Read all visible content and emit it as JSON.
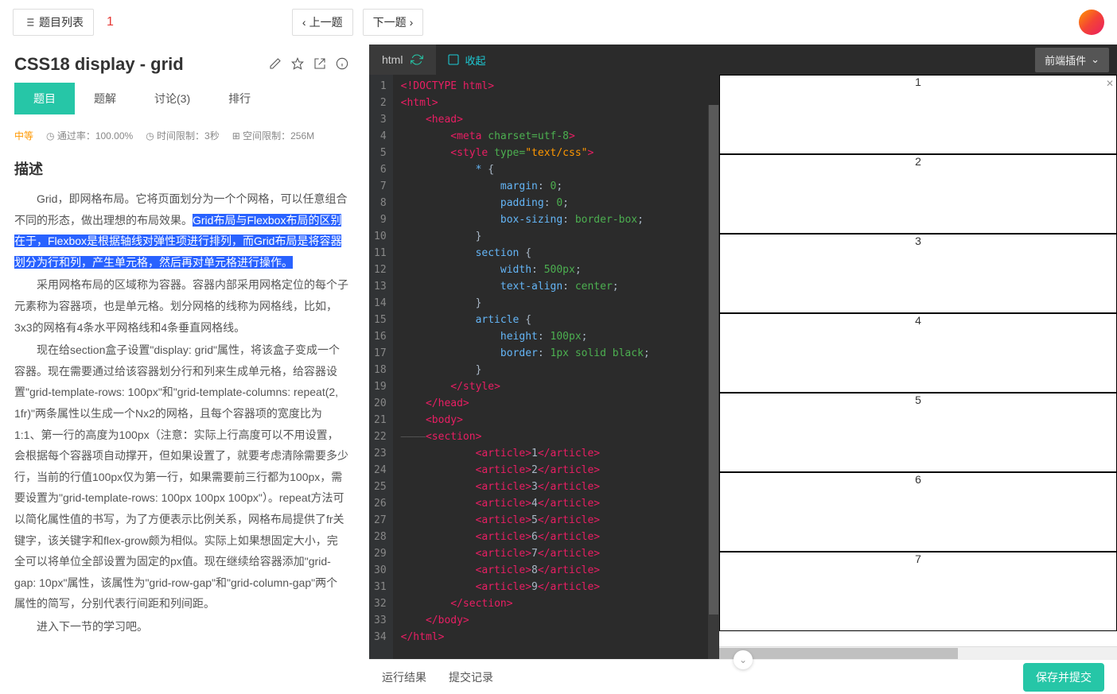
{
  "topbar": {
    "list_btn": "题目列表",
    "counter": "1",
    "prev_btn": "上一题",
    "next_btn": "下一题"
  },
  "problem": {
    "title": "CSS18  display - grid",
    "tabs": {
      "desc": "题目",
      "solution": "题解",
      "discuss": "讨论(3)",
      "rank": "排行"
    },
    "difficulty": "中等",
    "pass_rate_label": "通过率：100.00%",
    "time_limit_label": "时间限制：3秒",
    "space_limit_label": "空间限制：256M",
    "desc_heading": "描述",
    "p1a": "Grid，即网格布局。它将页面划分为一个个网格，可以任意组合不同的形态，做出理想的布局效果。",
    "p1b": "Grid布局与Flexbox布局的区别在于，Flexbox是根据轴线对弹性项进行排列，而Grid布局是将容器划分为行和列，产生单元格，然后再对单元格进行操作。",
    "p2": "采用网格布局的区域称为容器。容器内部采用网格定位的每个子元素称为容器项，也是单元格。划分网格的线称为网格线，比如，3x3的网格有4条水平网格线和4条垂直网格线。",
    "p3": "现在给section盒子设置\"display: grid\"属性，将该盒子变成一个容器。现在需要通过给该容器划分行和列来生成单元格，给容器设置\"grid-template-rows: 100px\"和\"grid-template-columns: repeat(2, 1fr)\"两条属性以生成一个Nx2的网格，且每个容器项的宽度比为1:1、第一行的高度为100px（注意：实际上行高度可以不用设置，会根据每个容器项自动撑开，但如果设置了，就要考虑清除需要多少行，当前的行值100px仅为第一行，如果需要前三行都为100px，需要设置为\"grid-template-rows: 100px 100px 100px\"）。repeat方法可以简化属性值的书写，为了方便表示比例关系，网格布局提供了fr关键字，该关键字和flex-grow颇为相似。实际上如果想固定大小，完全可以将单位全部设置为固定的px值。现在继续给容器添加\"grid-gap: 10px\"属性，该属性为\"grid-row-gap\"和\"grid-column-gap\"两个属性的简写，分别代表行间距和列间距。",
    "p4": "进入下一节的学习吧。"
  },
  "editor": {
    "lang": "html",
    "fold_label": "收起",
    "plugin_btn": "前端插件",
    "gutter": [
      "1",
      "2",
      "3",
      "4",
      "5",
      "6",
      "7",
      "8",
      "9",
      "10",
      "11",
      "12",
      "13",
      "14",
      "15",
      "16",
      "17",
      "18",
      "19",
      "20",
      "21",
      "22",
      "23",
      "24",
      "25",
      "26",
      "27",
      "28",
      "29",
      "30",
      "31",
      "32",
      "33",
      "34"
    ],
    "articles": [
      "1",
      "2",
      "3",
      "4",
      "5",
      "6",
      "7",
      "8",
      "9"
    ]
  },
  "preview": {
    "items": [
      "1",
      "2",
      "3",
      "4",
      "5",
      "6",
      "7"
    ]
  },
  "bottom": {
    "run_result": "运行结果",
    "submit_history": "提交记录",
    "submit_btn": "保存并提交"
  }
}
